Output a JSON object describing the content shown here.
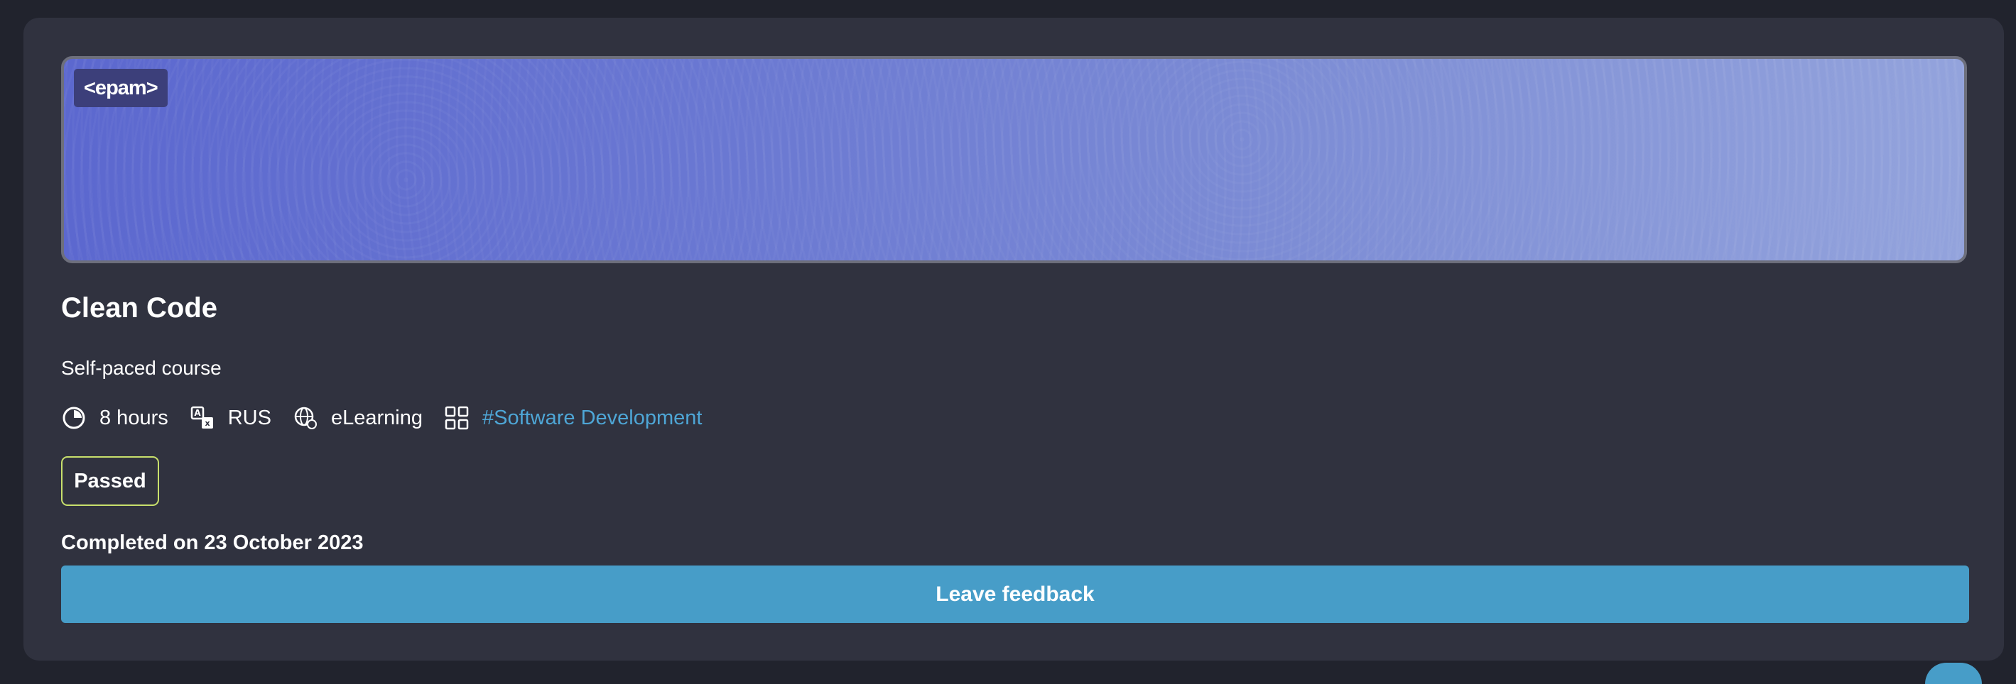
{
  "course": {
    "brand": "<epam>",
    "title": "Clean Code",
    "subtitle": "Self-paced course",
    "meta": {
      "duration": "8 hours",
      "language": "RUS",
      "format": "eLearning",
      "category_tag": "#Software Development"
    },
    "icons": {
      "duration": "clock-icon",
      "language": "translate-icon",
      "format": "globe-icon",
      "category": "grid-icon"
    },
    "status_badge": "Passed",
    "completed_text": "Completed on 23 October 2023",
    "feedback_button": "Leave feedback"
  },
  "colors": {
    "page_bg": "#21232d",
    "card_bg": "#30323f",
    "accent": "#479dc8",
    "tag_link": "#4ea6d6",
    "badge_border": "#c8e06c",
    "banner_start": "#5c68cf",
    "banner_end": "#93a3dc"
  }
}
